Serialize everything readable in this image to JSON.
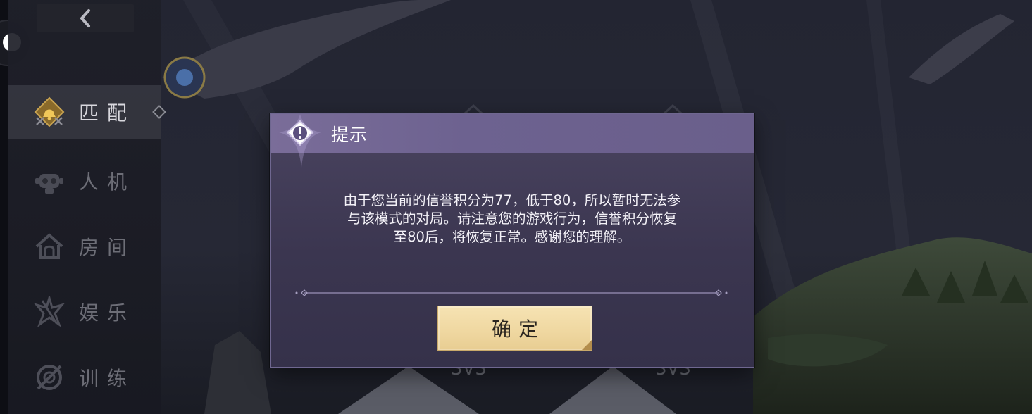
{
  "sidebar": {
    "back_icon": "chevron-left-icon",
    "items": [
      {
        "label": "匹配",
        "icon": "bell-crossed-swords-icon",
        "active": true
      },
      {
        "label": "人机",
        "icon": "robot-icon",
        "active": false
      },
      {
        "label": "房间",
        "icon": "house-icon",
        "active": false
      },
      {
        "label": "娱乐",
        "icon": "star-burst-icon",
        "active": false
      },
      {
        "label": "训练",
        "icon": "target-slash-icon",
        "active": false
      }
    ]
  },
  "dialog": {
    "title": "提示",
    "message_lines": [
      "由于您当前的信誉积分为77，低于80，所以暂时无法参",
      "与该模式的对局。请注意您的游戏行为，信誉积分恢复",
      "至80后，将恢复正常。感谢您的理解。"
    ],
    "confirm_label": "确定",
    "icon": "exclamation-icon"
  },
  "colors": {
    "dialog_header": "#7a6d99",
    "dialog_body": "#3b3650",
    "confirm_button": "#efd7a0",
    "active_nav_text": "#d9d8de",
    "inactive_nav_text": "#6d6e77"
  }
}
